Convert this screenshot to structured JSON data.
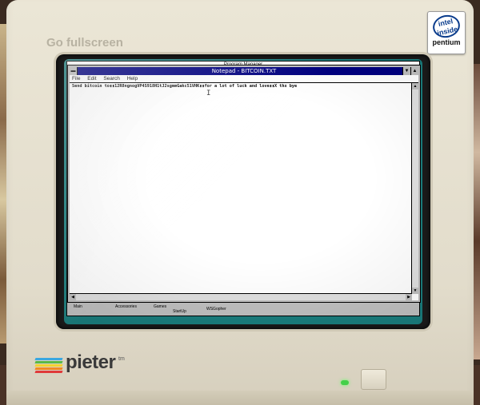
{
  "page": {
    "fullscreen_link": "Go fullscreen"
  },
  "badge": {
    "logo_line1": "intel",
    "logo_line2": "inside",
    "product": "pentium"
  },
  "brand": {
    "name": "pieter",
    "tm": "tm",
    "stripe_colors": [
      "#3aa7e0",
      "#58b947",
      "#f2d22e",
      "#f08a24",
      "#e03a3a"
    ]
  },
  "progman": {
    "title": "Program Manager",
    "groups": [
      "Main",
      "Accessories",
      "Games",
      "StartUp",
      "WSGopher"
    ]
  },
  "notepad": {
    "title": "Notepad - BITCOIN.TXT",
    "menu": [
      "File",
      "Edit",
      "Search",
      "Help"
    ],
    "content": "Send bitcoin to▮▮12R8ngnogVP4S918H1tJ2sgmmGakc51VHK▮▮for a lot of luck and love▮▮X thx bye",
    "colors": {
      "titlebar": "#000080",
      "desktop": "#1b7e7e"
    }
  }
}
